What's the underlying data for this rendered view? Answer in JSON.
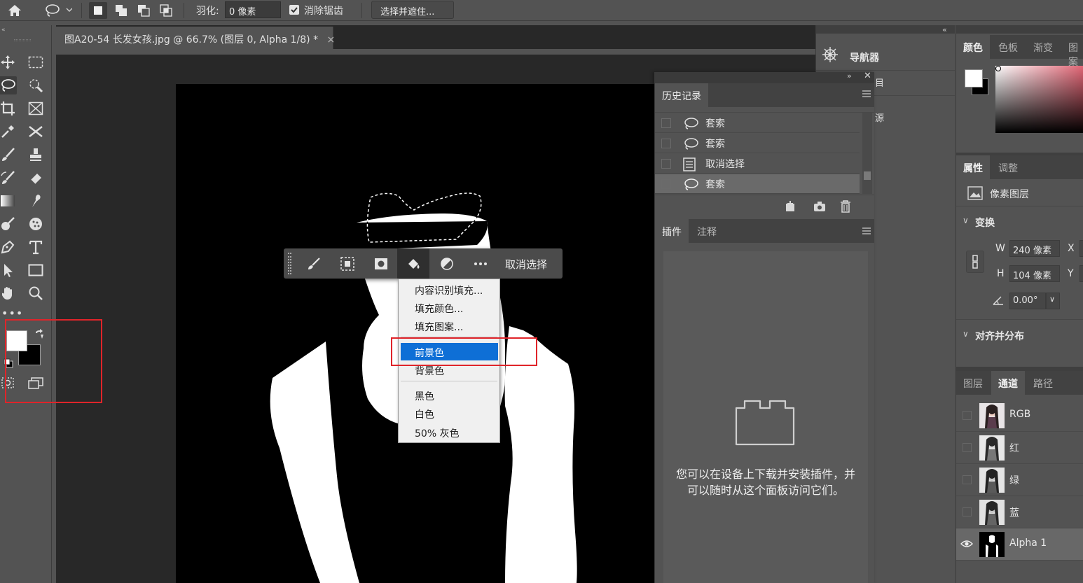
{
  "options": {
    "feather_label": "羽化:",
    "feather_value": "0 像素",
    "antialias_label": "消除锯齿",
    "select_mask_button": "选择并遮住..."
  },
  "document": {
    "tab_title": "图A20-54 长发女孩.jpg @ 66.7% (图层 0, Alpha 1/8) *",
    "close": "×"
  },
  "taskbar": {
    "deselect_label": "取消选择"
  },
  "fill_menu": {
    "items": [
      "内容识别填充...",
      "填充颜色...",
      "填充图案...",
      "前景色",
      "背景色",
      "黑色",
      "白色",
      "50% 灰色"
    ],
    "highlighted": "前景色"
  },
  "history": {
    "tab_label": "历史记录",
    "rows": [
      {
        "icon": "lasso-icon",
        "label": "套索"
      },
      {
        "icon": "lasso-icon",
        "label": "套索"
      },
      {
        "icon": "document-icon",
        "label": "取消选择"
      },
      {
        "icon": "lasso-icon",
        "label": "套索"
      }
    ]
  },
  "plugins": {
    "tab_plugins": "插件",
    "tab_notes": "注释",
    "message": "您可以在设备上下载并安装插件，并可以随时从这个面板访问它们。"
  },
  "navigator": {
    "label": "导航器",
    "partial_1": "目",
    "partial_2": "源"
  },
  "color_panel": {
    "tabs": [
      "颜色",
      "色板",
      "渐变",
      "图案"
    ],
    "accent_colors": [
      "#ffffff",
      "#000000"
    ]
  },
  "properties": {
    "tabs": [
      "属性",
      "调整"
    ],
    "layer_type": "像素图层",
    "transform_label": "变换",
    "w_label": "W",
    "w_value": "240 像素",
    "h_label": "H",
    "h_value": "104 像素",
    "x_label": "X",
    "y_label": "Y",
    "angle_value": "0.00°",
    "align_label": "对齐并分布"
  },
  "channels": {
    "tabs": [
      "图层",
      "通道",
      "路径"
    ],
    "rows": [
      {
        "label": "RGB"
      },
      {
        "label": "红"
      },
      {
        "label": "绿"
      },
      {
        "label": "蓝"
      },
      {
        "label": "Alpha 1"
      }
    ]
  },
  "colors": {
    "highlight": "#0e6fd6",
    "annotation_red": "#e0242a",
    "canvas_bg": "#000000",
    "panel_bg": "#535353"
  }
}
